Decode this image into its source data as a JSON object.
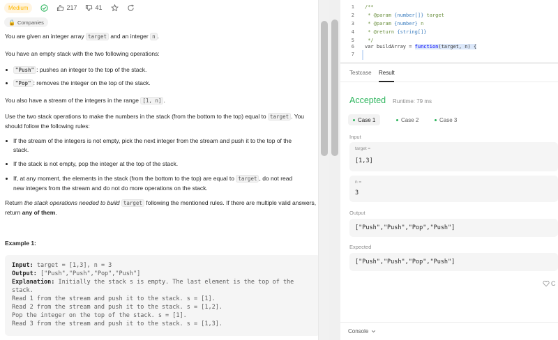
{
  "header": {
    "difficulty": "Medium",
    "likes": "217",
    "dislikes": "41",
    "companies": "Companies"
  },
  "description": {
    "p1_a": "You are given an integer array ",
    "p1_code1": "target",
    "p1_b": " and an integer ",
    "p1_code2": "n",
    "p1_c": ".",
    "p2": "You have an empty stack with the two following operations:",
    "op1_code": "\"Push\"",
    "op1_text": ": pushes an integer to the top of the stack.",
    "op2_code": "\"Pop\"",
    "op2_text": ": removes the integer on the top of the stack.",
    "p3_a": "You also have a stream of the integers in the range ",
    "p3_code": "[1, n]",
    "p3_b": ".",
    "p4_a": "Use the two stack operations to make the numbers in the stack (from the bottom to the top) equal to ",
    "p4_code": "target",
    "p4_b": ". You should follow the following rules:",
    "rule1": "If the stream of the integers is not empty, pick the next integer from the stream and push it to the top of the stack.",
    "rule2": "If the stack is not empty, pop the integer at the top of the stack.",
    "rule3_a": "If, at any moment, the elements in the stack (from the bottom to the top) are equal to ",
    "rule3_code": "target",
    "rule3_b": ", do not read new integers from the stream and do not do more operations on the stack.",
    "p5_a": "Return ",
    "p5_i": "the stack operations needed to build ",
    "p5_code": "target",
    "p5_b": " following the mentioned rules. If there are multiple valid answers, return ",
    "p5_bold": "any of them",
    "p5_c": "."
  },
  "example": {
    "title": "Example 1:",
    "input_label": "Input:",
    "input_value": " target = [1,3], n = 3",
    "output_label": "Output:",
    "output_value": " [\"Push\",\"Push\",\"Pop\",\"Push\"]",
    "explanation_label": "Explanation:",
    "explanation_text": " Initially the stack s is empty. The last element is the top of the stack.",
    "lines": [
      "Read 1 from the stream and push it to the stack. s = [1].",
      "Read 2 from the stream and push it to the stack. s = [1,2].",
      "Pop the integer on the top of the stack. s = [1].",
      "Read 3 from the stream and push it to the stack. s = [1,3]."
    ]
  },
  "editor": {
    "line_numbers": [
      "1",
      "2",
      "3",
      "4",
      "5",
      "6",
      "7"
    ],
    "l1": "/**",
    "l2_a": " * @param ",
    "l2_type": "{number[]}",
    "l2_b": " target",
    "l3_a": " * @param ",
    "l3_type": "{number}",
    "l3_b": " n",
    "l4_a": " * @return ",
    "l4_type": "{string[]}",
    "l5": " */",
    "l6_a": "var buildArray = ",
    "l6_kw": "function",
    "l6_b": "(target, n) {"
  },
  "console": {
    "tab_testcase": "Testcase",
    "tab_result": "Result",
    "status": "Accepted",
    "runtime": "Runtime: 79 ms",
    "cases": [
      "Case 1",
      "Case 2",
      "Case 3"
    ],
    "input_label": "Input",
    "param1_name": "target =",
    "param1_value": "[1,3]",
    "param2_name": "n =",
    "param2_value": "3",
    "output_label": "Output",
    "output_value": "[\"Push\",\"Push\",\"Pop\",\"Push\"]",
    "expected_label": "Expected",
    "expected_value": "[\"Push\",\"Push\",\"Pop\",\"Push\"]",
    "feedback": "C",
    "footer_label": "Console"
  },
  "colors": {
    "accepted": "#2db55d",
    "medium": "#ffb800"
  }
}
